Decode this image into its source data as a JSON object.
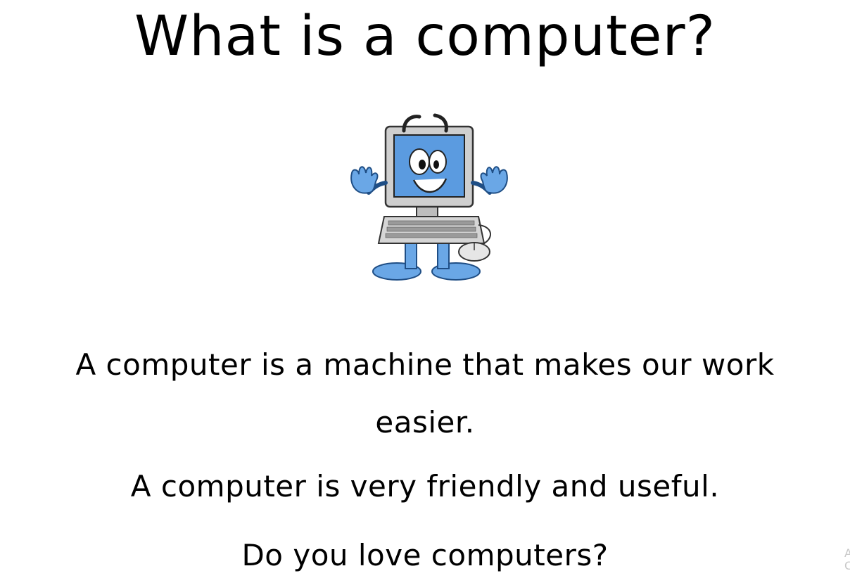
{
  "slide": {
    "title": "What is a computer?",
    "paragraphs": [
      "A computer is a machine that makes our work easier.",
      "A computer is very friendly and useful.",
      "Do you love computers?"
    ],
    "corner_fragment": "A\nC"
  },
  "illustration": {
    "icon": "smiling-computer-cartoon-icon",
    "colors": {
      "screen": "#5b9be0",
      "body": "#c9c9c9",
      "outline": "#222222",
      "hands_feet": "#6aa7e6"
    }
  }
}
